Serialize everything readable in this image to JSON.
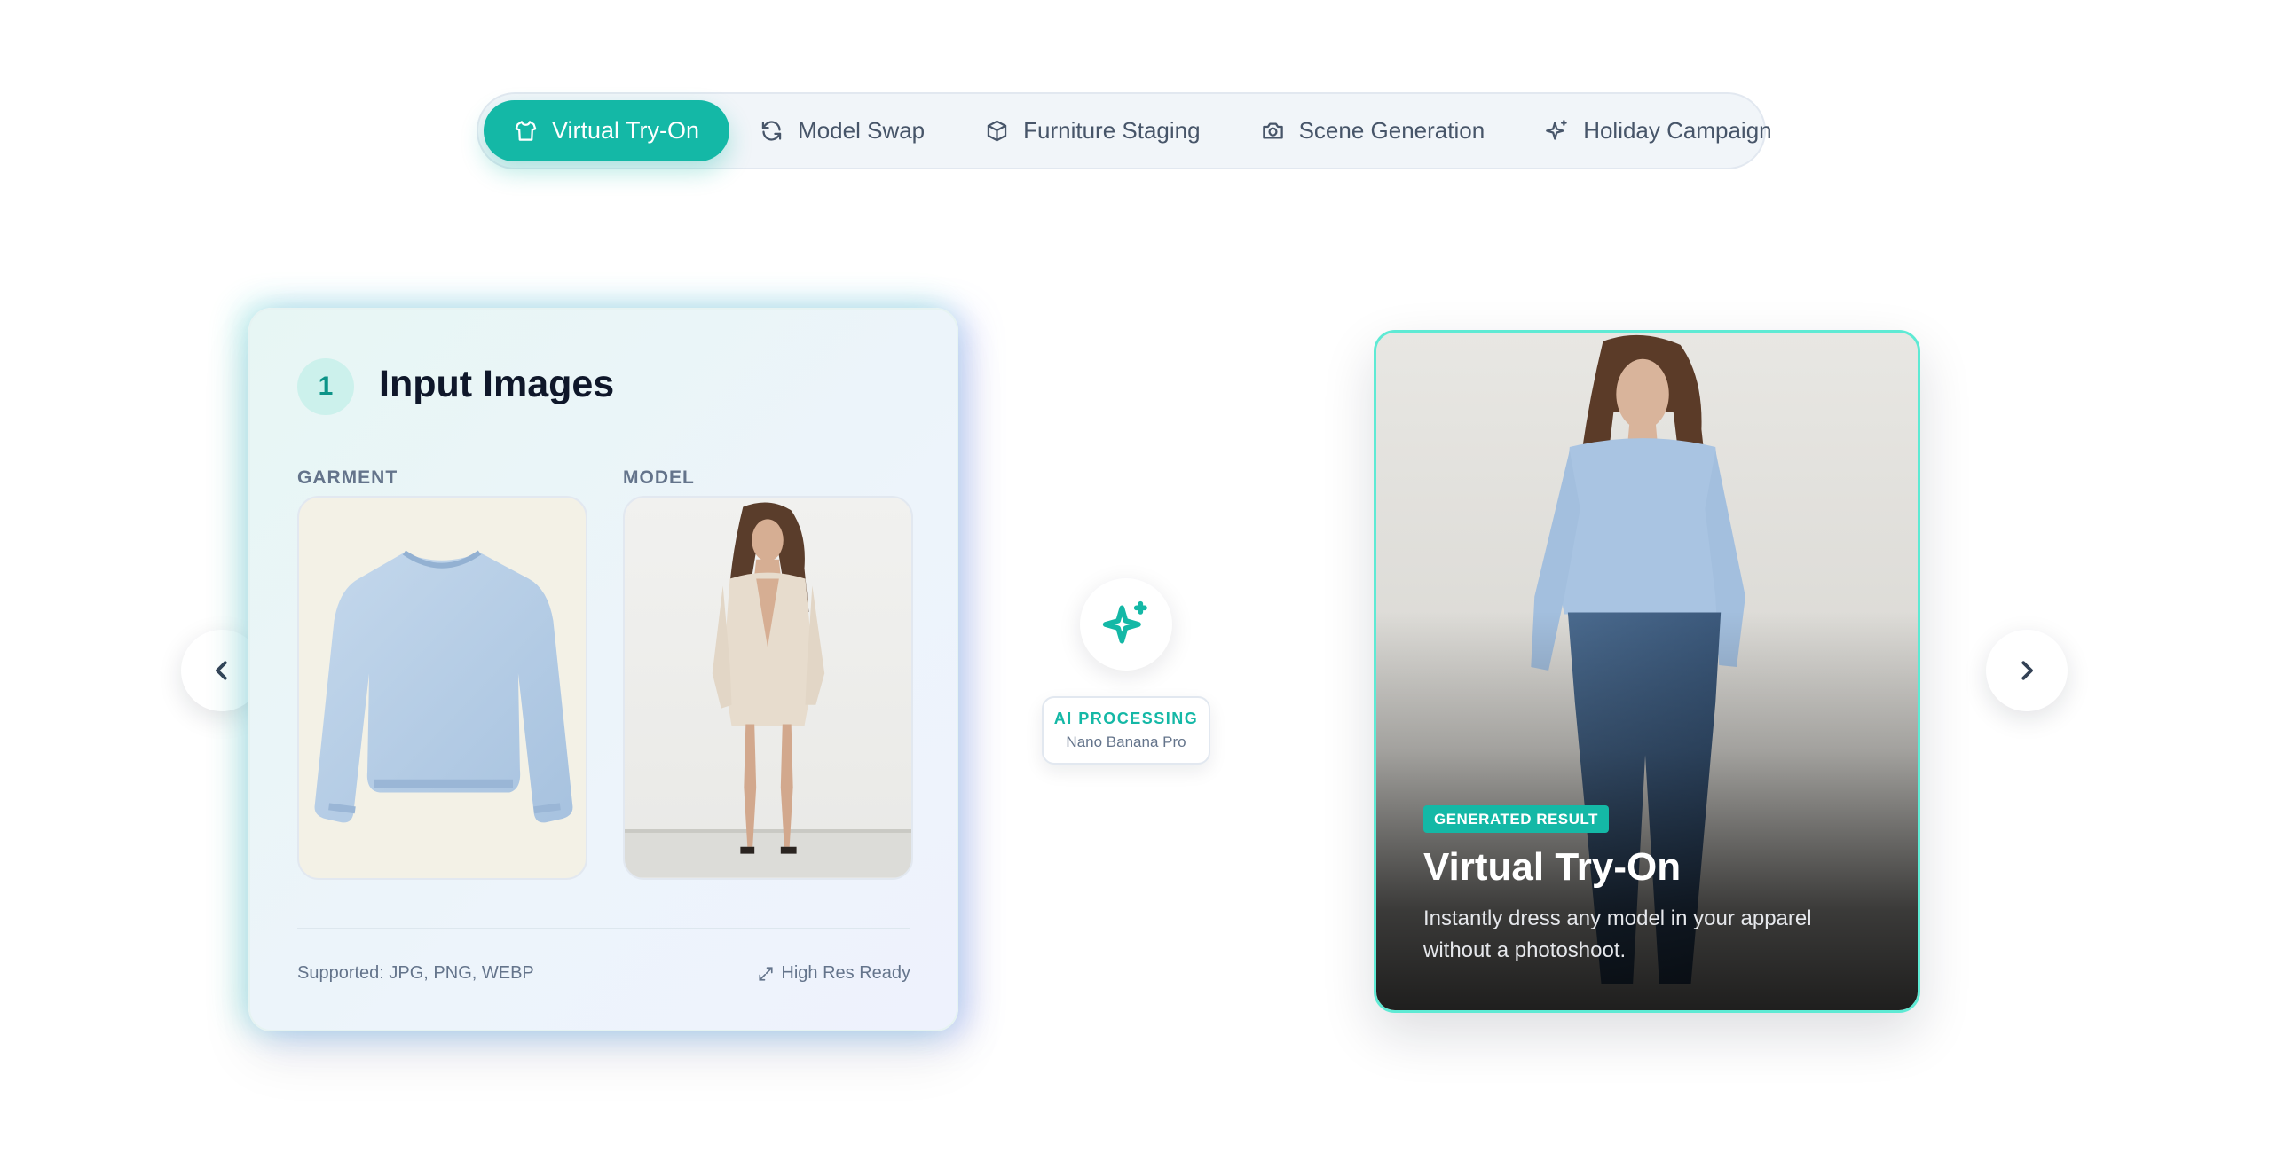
{
  "tabs": [
    {
      "label": "Virtual Try-On",
      "icon": "shirt-icon",
      "active": true
    },
    {
      "label": "Model Swap",
      "icon": "refresh-icon",
      "active": false
    },
    {
      "label": "Furniture Staging",
      "icon": "box-icon",
      "active": false
    },
    {
      "label": "Scene Generation",
      "icon": "camera-icon",
      "active": false
    },
    {
      "label": "Holiday Campaign",
      "icon": "sparkles-icon",
      "active": false
    }
  ],
  "input_card": {
    "step_number": "1",
    "title": "Input Images",
    "garment_label": "GARMENT",
    "model_label": "MODEL",
    "supported_formats": "Supported: JPG, PNG, WEBP",
    "high_res": "High Res Ready"
  },
  "processing": {
    "title": "AI PROCESSING",
    "subtitle": "Nano Banana Pro"
  },
  "result_card": {
    "badge": "GENERATED RESULT",
    "title": "Virtual Try-On",
    "description": "Instantly dress any model in your apparel without a photoshoot."
  },
  "colors": {
    "accent": "#14b8a6",
    "accent_light": "#5eead4"
  }
}
